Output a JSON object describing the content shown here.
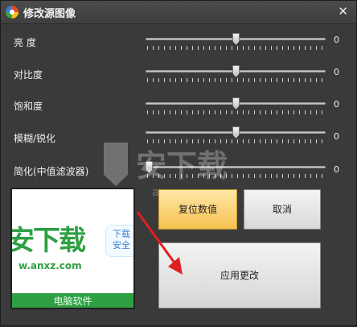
{
  "window": {
    "title": "修改源图像",
    "close_glyph": "✕"
  },
  "sliders": [
    {
      "label": "亮  度",
      "value": "0",
      "position": 0.5
    },
    {
      "label": "对比度",
      "value": "0",
      "position": 0.5
    },
    {
      "label": "饱和度",
      "value": "0",
      "position": 0.5
    },
    {
      "label": "模糊/锐化",
      "value": "0",
      "position": 0.5
    },
    {
      "label": "简化(中值滤波器)",
      "value": "0",
      "position": 0.0
    }
  ],
  "preview": {
    "brand": "安下载",
    "url": "w.anxz.com",
    "bubble": "下载\n安全",
    "band": "电脑软件"
  },
  "buttons": {
    "reset": "复位数值",
    "cancel": "取消",
    "apply": "应用更改"
  },
  "watermark": {
    "text": "安下载",
    "sub": "anxz.com"
  },
  "colors": {
    "reset_bg": "#f5c24f",
    "annotation_arrow": "#e02020",
    "preview_green": "#2ea043"
  }
}
